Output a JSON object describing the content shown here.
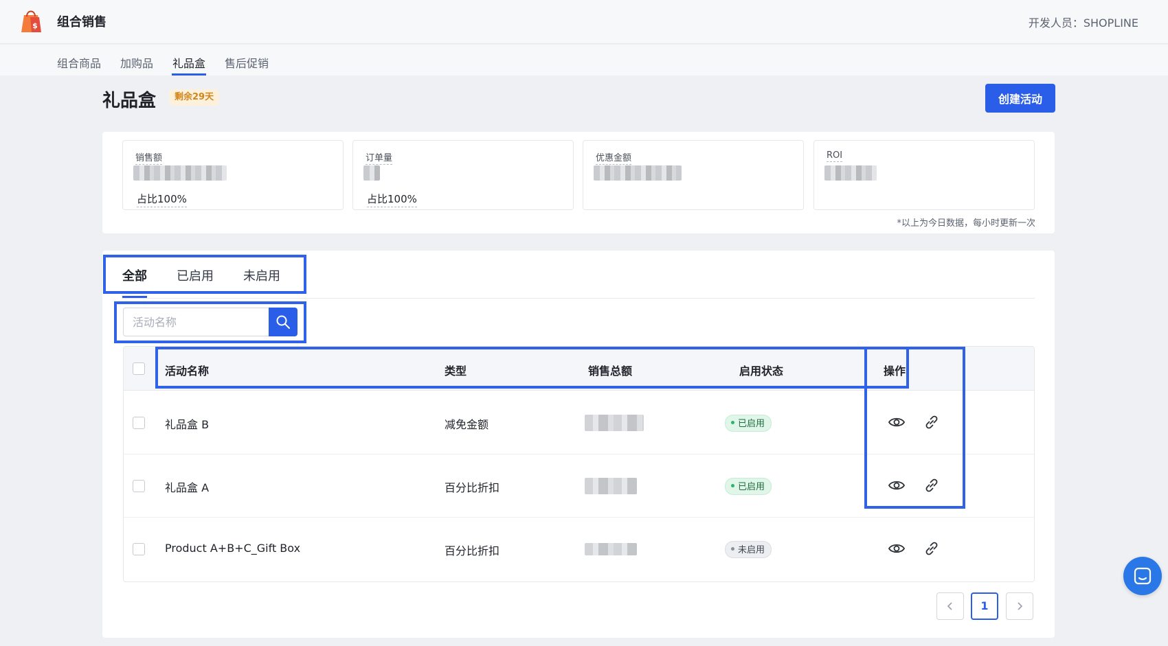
{
  "header": {
    "app_title": "组合销售",
    "developer": "开发人员：SHOPLINE",
    "logo_icon": "shopping-bag-icon",
    "brand_color": "#f47b3b"
  },
  "subnav": {
    "items": [
      {
        "label": "组合商品",
        "active": false
      },
      {
        "label": "加购品",
        "active": false
      },
      {
        "label": "礼品盒",
        "active": true
      },
      {
        "label": "售后促销",
        "active": false
      }
    ]
  },
  "page": {
    "title": "礼品盒",
    "badge": "剩余29天",
    "create_button": "创建活动"
  },
  "stats": {
    "items": [
      {
        "label": "销售额",
        "share": "占比100%"
      },
      {
        "label": "订单量",
        "share": "占比100%"
      },
      {
        "label": "优惠金额",
        "share": ""
      },
      {
        "label": "ROI",
        "share": ""
      }
    ],
    "note": "*以上为今日数据，每小时更新一次"
  },
  "filters": {
    "tabs": [
      {
        "label": "全部",
        "active": true
      },
      {
        "label": "已启用",
        "active": false
      },
      {
        "label": "未启用",
        "active": false
      }
    ]
  },
  "search": {
    "placeholder": "活动名称",
    "icon": "search-icon"
  },
  "table": {
    "columns": [
      "活动名称",
      "类型",
      "销售总额",
      "启用状态",
      "操作"
    ],
    "rows": [
      {
        "name": "礼品盒 B",
        "type": "减免金额",
        "status": "已启用",
        "enabled": true
      },
      {
        "name": "礼品盒 A",
        "type": "百分比折扣",
        "status": "已启用",
        "enabled": true
      },
      {
        "name": "Product A+B+C_Gift Box",
        "type": "百分比折扣",
        "status": "未启用",
        "enabled": false
      }
    ],
    "action_icons": [
      "eye-icon",
      "link-icon"
    ]
  },
  "pagination": {
    "current": "1",
    "prev_icon": "chevron-left-icon",
    "next_icon": "chevron-right-icon"
  },
  "colors": {
    "accent": "#2a5ee8",
    "highlight": "#2f62e9",
    "enabled_badge": "#dff6e8",
    "disabled_badge": "#eceef2"
  }
}
